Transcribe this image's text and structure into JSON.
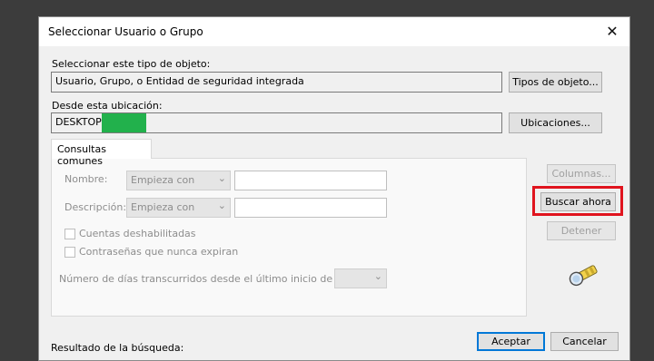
{
  "dialog": {
    "title": "Seleccionar Usuario o Grupo",
    "close_glyph": "✕"
  },
  "object_type": {
    "label": "Seleccionar este tipo de objeto:",
    "value": "Usuario, Grupo, o Entidad de seguridad integrada",
    "button": "Tipos de objeto..."
  },
  "location": {
    "label": "Desde esta ubicación:",
    "value": "DESKTOP-",
    "redaction_color": "#22b14c",
    "button": "Ubicaciones..."
  },
  "common_queries": {
    "tab": "Consultas comunes",
    "name_label": "Nombre:",
    "name_mode": "Empieza con",
    "desc_label": "Descripción:",
    "desc_mode": "Empieza con",
    "chk_disabled": "Cuentas deshabilitadas",
    "chk_noexpire": "Contraseñas que nunca expiran",
    "days_label": "Número de días transcurridos desde el último inicio de sesión:",
    "chevron": "⌄"
  },
  "side_buttons": {
    "columns": "Columnas...",
    "search_now": "Buscar ahora",
    "stop": "Detener",
    "search_icon": "flashlight-search-icon"
  },
  "footer": {
    "results_label": "Resultado de la búsqueda:",
    "ok": "Aceptar",
    "cancel": "Cancelar"
  },
  "colors": {
    "highlight": "#e0141e",
    "accent": "#0078d7"
  }
}
